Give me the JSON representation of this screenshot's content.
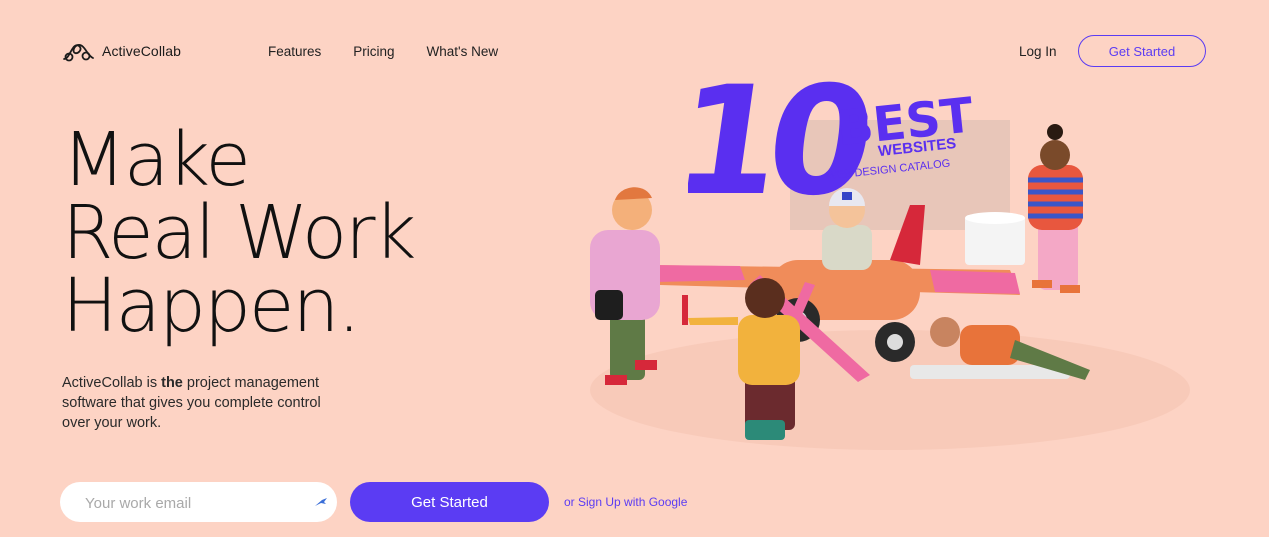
{
  "nav": {
    "brand": "ActiveCollab",
    "links": [
      "Features",
      "Pricing",
      "What's New"
    ],
    "login": "Log In",
    "cta": "Get Started"
  },
  "hero": {
    "title_lines": [
      "Make",
      "Real Work",
      "Happen."
    ],
    "subtitle_pre": "ActiveCollab is ",
    "subtitle_bold": "the",
    "subtitle_post": " project management software that gives you complete control over your work.",
    "email_placeholder": "Your work email",
    "cta": "Get Started",
    "google": "or Sign Up with Google"
  },
  "badge": {
    "number": "10",
    "best": "BEST",
    "websites": "WEBSITES",
    "catalog": "WEB DESIGN CATALOG"
  },
  "colors": {
    "background": "#fdd3c4",
    "accent": "#5b3cf3",
    "badge": "#5a2ff0"
  }
}
